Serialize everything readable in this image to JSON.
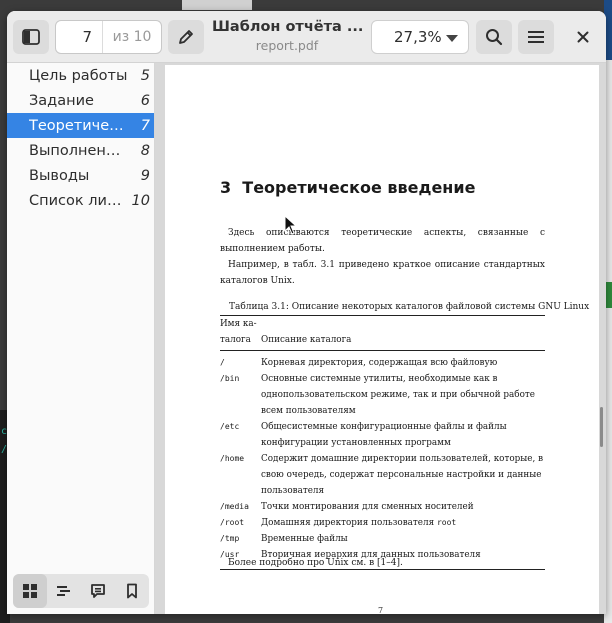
{
  "app": {
    "title": "Шаблон отчёта ...",
    "filename": "report.pdf",
    "page_current": "7",
    "page_total": "из 10",
    "zoom": "27,3%",
    "icons": {
      "sidebar_toggle": "sidebar-toggle-icon",
      "annotate": "pencil-icon",
      "search": "search-icon",
      "menu": "hamburger-menu-icon",
      "close": "close-icon"
    }
  },
  "sidebar": {
    "outline": [
      {
        "label": "Цель работы",
        "page": "5"
      },
      {
        "label": "Задание",
        "page": "6"
      },
      {
        "label": "Теоретичес…",
        "page": "7"
      },
      {
        "label": "Выполнение…",
        "page": "8"
      },
      {
        "label": "Выводы",
        "page": "9"
      },
      {
        "label": "Список лите…",
        "page": "10"
      }
    ],
    "selected_index": 2,
    "tabs": [
      "thumbnails-icon",
      "outline-icon",
      "annotations-icon",
      "bookmarks-icon"
    ]
  },
  "document": {
    "section_number": "3",
    "section_title": "Теоретическое введение",
    "para1": "Здесь описываются теоретические аспекты, связанные с выполнением работы.",
    "para2": "Например, в табл. 3.1 приведено краткое описание стандартных каталогов Unix.",
    "caption": "Таблица 3.1: Описание некоторых каталогов файловой системы GNU Linux",
    "table_header": {
      "col1_line1": "Имя ка-",
      "col1_line2": "талога",
      "col2": "Описание каталога"
    },
    "table_rows": [
      {
        "name": "/",
        "desc": "Корневая директория, содержащая всю файловую"
      },
      {
        "name": "/bin",
        "desc": "Основные системные утилиты, необходимые как в однопользовательском режиме, так и при обычной работе всем пользователям"
      },
      {
        "name": "/etc",
        "desc": "Общесистемные конфигурационные файлы и файлы конфигурации установленных программ"
      },
      {
        "name": "/home",
        "desc": "Содержит домашние директории пользователей, которые, в свою очередь, содержат персональные настройки и данные пользователя"
      },
      {
        "name": "/media",
        "desc": "Точки монтирования для сменных носителей"
      },
      {
        "name": "/root",
        "desc_prefix": "Домашняя директория пользователя ",
        "desc_mono": "root"
      },
      {
        "name": "/tmp",
        "desc": "Временные файлы"
      },
      {
        "name": "/usr",
        "desc": "Вторичная иерархия для данных пользователя"
      }
    ],
    "footer_text": "Более подробно про Unix см. в [1–4].",
    "page_number": "7"
  },
  "colors": {
    "accent": "#3584e4",
    "header": "#ebebeb",
    "sidebar": "#fafafa"
  }
}
